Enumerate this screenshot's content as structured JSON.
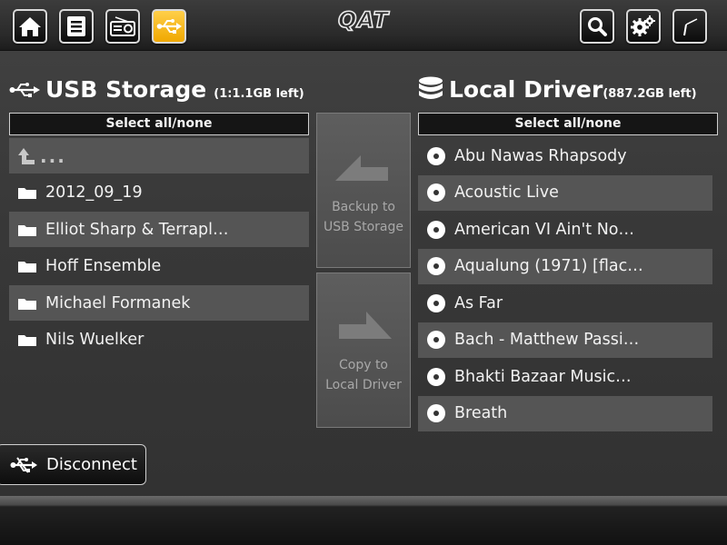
{
  "header": {
    "logo": "QAT",
    "nav_buttons": [
      {
        "icon": "home-icon",
        "active": false
      },
      {
        "icon": "list-icon",
        "active": false
      },
      {
        "icon": "radio-icon",
        "active": false
      },
      {
        "icon": "usb-icon",
        "active": true
      }
    ],
    "right_buttons": [
      {
        "icon": "search-icon"
      },
      {
        "icon": "gear-icon"
      },
      {
        "icon": "signal-icon"
      }
    ]
  },
  "usb": {
    "title": "USB Storage",
    "space": "(1:1.1GB left)",
    "select_label": "Select all/none",
    "up_label": "...",
    "items": [
      "2012_09_19",
      "Elliot Sharp & Terrapl…",
      "Hoff Ensemble",
      "Michael Formanek",
      "Nils Wuelker"
    ]
  },
  "local": {
    "title": "Local Driver",
    "space": "(887.2GB left)",
    "select_label": "Select all/none",
    "items": [
      "Abu Nawas Rhapsody",
      "Acoustic Live",
      "American VI  Ain't No…",
      "Aqualung (1971) [flac…",
      "As Far",
      "Bach - Matthew Passi…",
      "Bhakti Bazaar  Music…",
      "Breath"
    ]
  },
  "actions": {
    "backup_line1": "Backup to",
    "backup_line2": "USB Storage",
    "copy_line1": "Copy to",
    "copy_line2": "Local Driver",
    "disconnect": "Disconnect"
  },
  "colors": {
    "accent": "#f5b400",
    "row_alt": "#555555",
    "background": "#3a3a3a"
  }
}
